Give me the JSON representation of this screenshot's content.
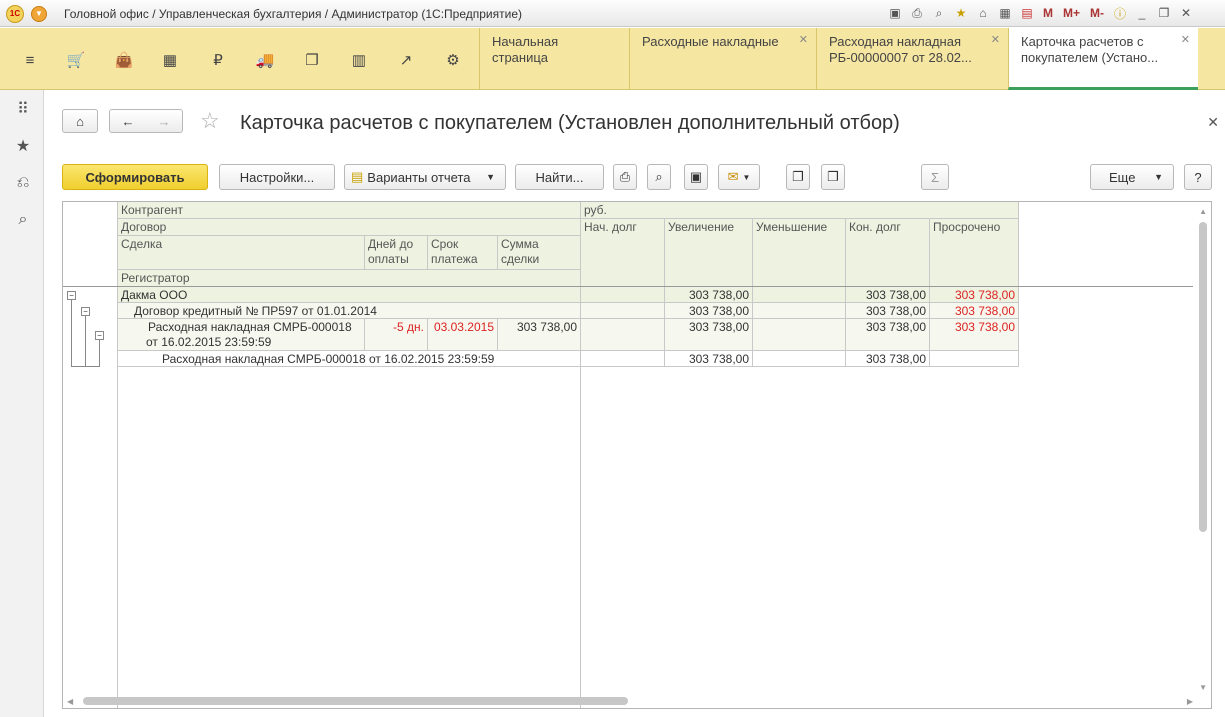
{
  "titlebar": {
    "logo": "1С",
    "title": "Головной офис / Управленческая бухгалтерия / Администратор  (1С:Предприятие)",
    "m_labels": [
      "M",
      "M+",
      "M-"
    ]
  },
  "tabs": [
    {
      "label": "Начальная страница"
    },
    {
      "label": "Расходные накладные"
    },
    {
      "label": "Расходная накладная РБ-00000007 от 28.02..."
    },
    {
      "label": "Карточка расчетов с покупателем (Устано..."
    }
  ],
  "page": {
    "title": "Карточка расчетов с покупателем (Установлен дополнительный отбор)"
  },
  "commands": {
    "generate": "Сформировать",
    "settings": "Настройки...",
    "variants": "Варианты отчета",
    "find": "Найти...",
    "more": "Еще",
    "help": "?",
    "sum": "Σ"
  },
  "report": {
    "headers": {
      "counterparty": "Контрагент",
      "contract": "Договор",
      "deal": "Сделка",
      "days_to_pay": "Дней до оплаты",
      "due_date": "Срок платежа",
      "deal_sum": "Сумма сделки",
      "registrar": "Регистратор",
      "currency": "руб.",
      "start_debt": "Нач. долг",
      "increase": "Увеличение",
      "decrease": "Уменьшение",
      "end_debt": "Кон. долг",
      "overdue": "Просрочено"
    },
    "rows": [
      {
        "name": "Дакма ООО",
        "increase": "303 738,00",
        "end_debt": "303 738,00",
        "overdue": "303 738,00"
      },
      {
        "name": "Договор кредитный № ПР597 от 01.01.2014",
        "increase": "303 738,00",
        "end_debt": "303 738,00",
        "overdue": "303 738,00"
      },
      {
        "name_line1": "Расходная накладная СМРБ-000018",
        "name_line2": "от 16.02.2015 23:59:59",
        "days": "-5 дн.",
        "due": "03.03.2015",
        "sum": "303 738,00",
        "increase": "303 738,00",
        "end_debt": "303 738,00",
        "overdue": "303 738,00"
      },
      {
        "name": "Расходная накладная СМРБ-000018 от 16.02.2015 23:59:59",
        "increase": "303 738,00",
        "end_debt": "303 738,00"
      }
    ]
  }
}
